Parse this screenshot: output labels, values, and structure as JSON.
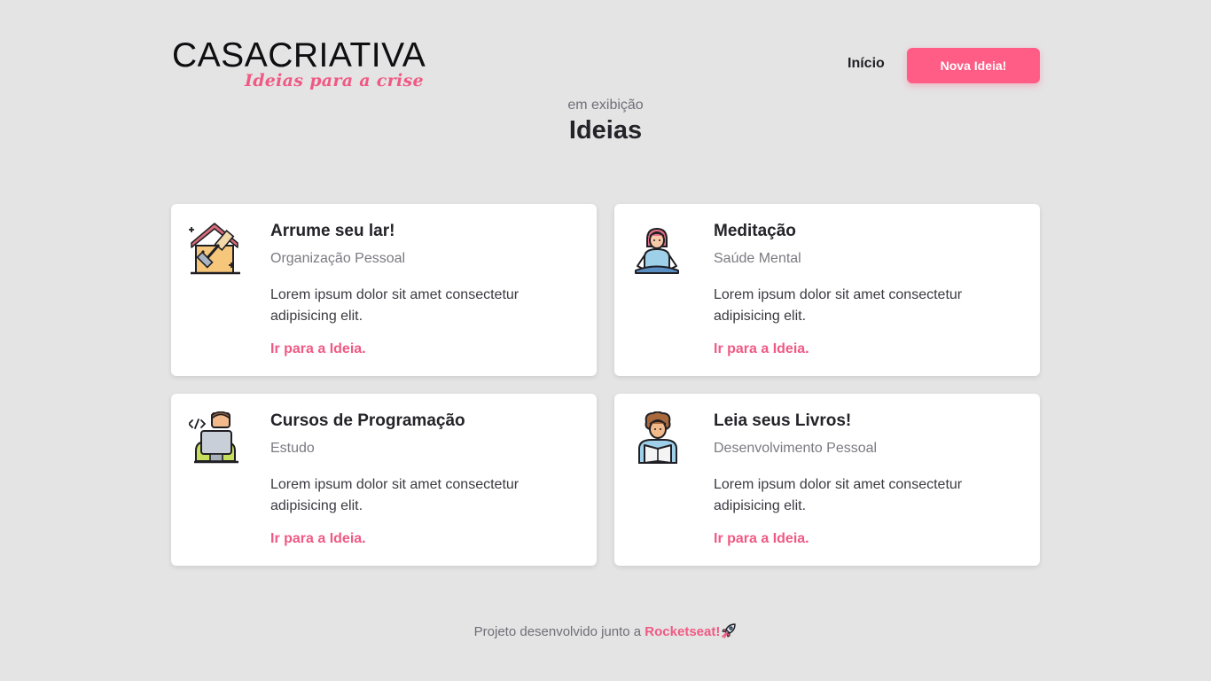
{
  "header": {
    "logo": {
      "word_bold": "CASA",
      "word_light": "CRIATIVA",
      "tagline": "Ideias para a crise"
    },
    "nav": {
      "home_label": "Início",
      "new_idea_label": "Nova Ideia!"
    }
  },
  "main": {
    "subtitle": "em exibição",
    "title": "Ideias",
    "cards": [
      {
        "icon": "house-cleaning-icon",
        "title": "Arrume seu lar!",
        "category": "Organização Pessoal",
        "description": "Lorem ipsum dolor sit amet consectetur adipisicing elit.",
        "link_label": "Ir para a Ideia."
      },
      {
        "icon": "meditation-icon",
        "title": "Meditação",
        "category": "Saúde Mental",
        "description": "Lorem ipsum dolor sit amet consectetur adipisicing elit.",
        "link_label": "Ir para a Ideia."
      },
      {
        "icon": "programmer-icon",
        "title": "Cursos de Programação",
        "category": "Estudo",
        "description": "Lorem ipsum dolor sit amet consectetur adipisicing elit.",
        "link_label": "Ir para a Ideia."
      },
      {
        "icon": "reading-icon",
        "title": "Leia seus Livros!",
        "category": "Desenvolvimento Pessoal",
        "description": "Lorem ipsum dolor sit amet consectetur adipisicing elit.",
        "link_label": "Ir para a Ideia."
      }
    ]
  },
  "footer": {
    "text": "Projeto desenvolvido junto a ",
    "link_label": "Rocketseat!",
    "icon": "rocket-icon"
  },
  "colors": {
    "background": "#e4e4e4",
    "accent": "#ff5d86",
    "card": "#ffffff",
    "text_dark": "#232329",
    "text_muted": "#7a7a82"
  }
}
